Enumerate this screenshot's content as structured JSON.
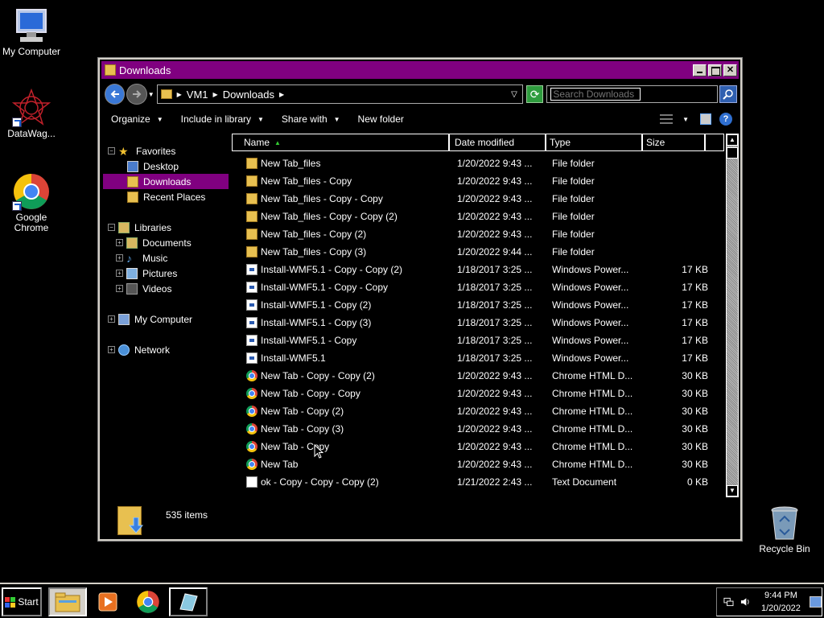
{
  "desktop": {
    "icons": [
      {
        "label": "My Computer"
      },
      {
        "label": "DataWag..."
      },
      {
        "label": "Google Chrome"
      },
      {
        "label": "Recycle Bin"
      }
    ]
  },
  "window": {
    "title": "Downloads",
    "address": {
      "crumbs": [
        "VM1",
        "Downloads"
      ],
      "search_placeholder": "Search Downloads"
    },
    "toolbar": {
      "organize": "Organize",
      "include_in_library": "Include in library",
      "share_with": "Share with",
      "new_folder": "New folder"
    },
    "nav": {
      "favorites": "Favorites",
      "desktop": "Desktop",
      "downloads": "Downloads",
      "recent_places": "Recent Places",
      "libraries": "Libraries",
      "documents": "Documents",
      "music": "Music",
      "pictures": "Pictures",
      "videos": "Videos",
      "my_computer": "My Computer",
      "network": "Network"
    },
    "columns": {
      "name": "Name",
      "date": "Date modified",
      "type": "Type",
      "size": "Size"
    },
    "files": [
      {
        "name": "New Tab_files",
        "date": "1/20/2022 9:43 ...",
        "type": "File folder",
        "size": "",
        "icon": "folder-icon"
      },
      {
        "name": "New Tab_files - Copy",
        "date": "1/20/2022 9:43 ...",
        "type": "File folder",
        "size": "",
        "icon": "folder-icon"
      },
      {
        "name": "New Tab_files - Copy - Copy",
        "date": "1/20/2022 9:43 ...",
        "type": "File folder",
        "size": "",
        "icon": "folder-icon"
      },
      {
        "name": "New Tab_files - Copy - Copy (2)",
        "date": "1/20/2022 9:43 ...",
        "type": "File folder",
        "size": "",
        "icon": "folder-icon"
      },
      {
        "name": "New Tab_files - Copy (2)",
        "date": "1/20/2022 9:43 ...",
        "type": "File folder",
        "size": "",
        "icon": "folder-icon"
      },
      {
        "name": "New Tab_files - Copy (3)",
        "date": "1/20/2022 9:44 ...",
        "type": "File folder",
        "size": "",
        "icon": "folder-icon"
      },
      {
        "name": "Install-WMF5.1 - Copy - Copy (2)",
        "date": "1/18/2017 3:25 ...",
        "type": "Windows Power...",
        "size": "17 KB",
        "icon": "powershell-script-icon"
      },
      {
        "name": "Install-WMF5.1 - Copy - Copy",
        "date": "1/18/2017 3:25 ...",
        "type": "Windows Power...",
        "size": "17 KB",
        "icon": "powershell-script-icon"
      },
      {
        "name": "Install-WMF5.1 - Copy (2)",
        "date": "1/18/2017 3:25 ...",
        "type": "Windows Power...",
        "size": "17 KB",
        "icon": "powershell-script-icon"
      },
      {
        "name": "Install-WMF5.1 - Copy (3)",
        "date": "1/18/2017 3:25 ...",
        "type": "Windows Power...",
        "size": "17 KB",
        "icon": "powershell-script-icon"
      },
      {
        "name": "Install-WMF5.1 - Copy",
        "date": "1/18/2017 3:25 ...",
        "type": "Windows Power...",
        "size": "17 KB",
        "icon": "powershell-script-icon"
      },
      {
        "name": "Install-WMF5.1",
        "date": "1/18/2017 3:25 ...",
        "type": "Windows Power...",
        "size": "17 KB",
        "icon": "powershell-script-icon"
      },
      {
        "name": "New Tab - Copy - Copy (2)",
        "date": "1/20/2022 9:43 ...",
        "type": "Chrome HTML D...",
        "size": "30 KB",
        "icon": "chrome-html-icon"
      },
      {
        "name": "New Tab - Copy - Copy",
        "date": "1/20/2022 9:43 ...",
        "type": "Chrome HTML D...",
        "size": "30 KB",
        "icon": "chrome-html-icon"
      },
      {
        "name": "New Tab - Copy (2)",
        "date": "1/20/2022 9:43 ...",
        "type": "Chrome HTML D...",
        "size": "30 KB",
        "icon": "chrome-html-icon"
      },
      {
        "name": "New Tab - Copy (3)",
        "date": "1/20/2022 9:43 ...",
        "type": "Chrome HTML D...",
        "size": "30 KB",
        "icon": "chrome-html-icon"
      },
      {
        "name": "New Tab - Copy",
        "date": "1/20/2022 9:43 ...",
        "type": "Chrome HTML D...",
        "size": "30 KB",
        "icon": "chrome-html-icon"
      },
      {
        "name": "New Tab",
        "date": "1/20/2022 9:43 ...",
        "type": "Chrome HTML D...",
        "size": "30 KB",
        "icon": "chrome-html-icon"
      },
      {
        "name": "ok - Copy - Copy - Copy (2)",
        "date": "1/21/2022 2:43 ...",
        "type": "Text Document",
        "size": "0 KB",
        "icon": "text-document-icon"
      }
    ],
    "status": {
      "items_count": "535 items"
    }
  },
  "taskbar": {
    "start_label": "Start",
    "clock_time": "9:44 PM",
    "clock_date": "1/20/2022"
  },
  "colors": {
    "titlebar": "#800080",
    "selection": "#800080",
    "background": "#000000"
  }
}
